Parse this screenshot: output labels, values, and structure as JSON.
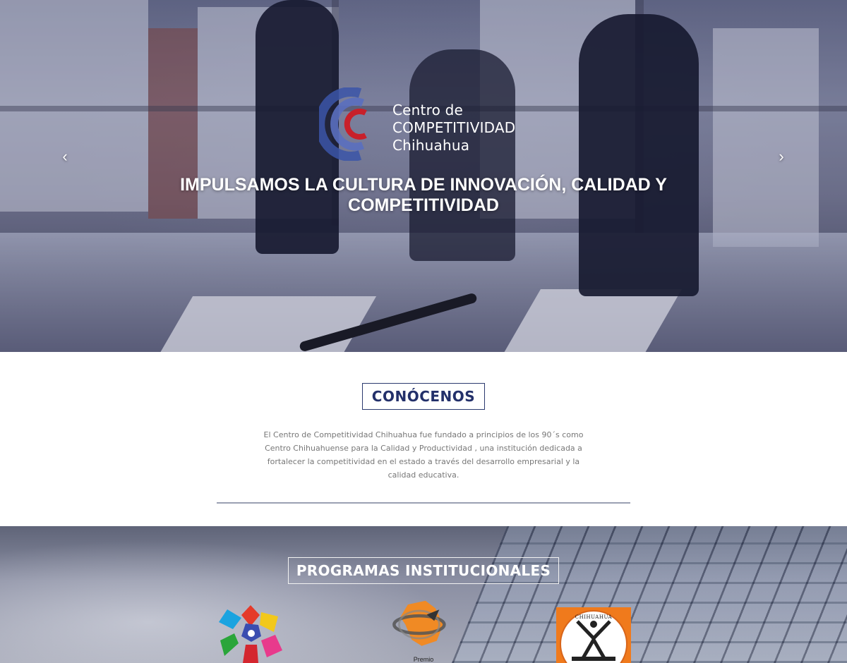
{
  "hero": {
    "prev_label": "‹",
    "next_label": "›",
    "logo": {
      "line1": "Centro de",
      "line2": "COMPETITIVIDAD",
      "line3": "Chihuahua",
      "colors": {
        "ring_blue": "#3b55a8",
        "ring_red": "#c8202a"
      }
    },
    "title_line1": "IMPULSAMOS LA CULTURA DE INNOVACIÓN, CALIDAD Y",
    "title_line2": "COMPETITIVIDAD"
  },
  "about": {
    "heading": "CONÓCENOS",
    "text": "El Centro de Competitividad Chihuahua fue fundado a principios de los 90´s como Centro Chihuahuense para la Calidad y Productividad , una institución dedicada a fortalecer la competitividad en el estado a través del desarrollo empresarial y la calidad educativa.",
    "accent_color": "#23306a"
  },
  "programs": {
    "heading": "PROGRAMAS INSTITUCIONALES",
    "items": [
      {
        "icon": "colorful-star-logo-icon"
      },
      {
        "icon": "premio-orange-map-logo-icon",
        "label": "Premio"
      },
      {
        "icon": "chihuahua-education-seal-icon",
        "label": "CHIHUAHUA"
      }
    ]
  }
}
